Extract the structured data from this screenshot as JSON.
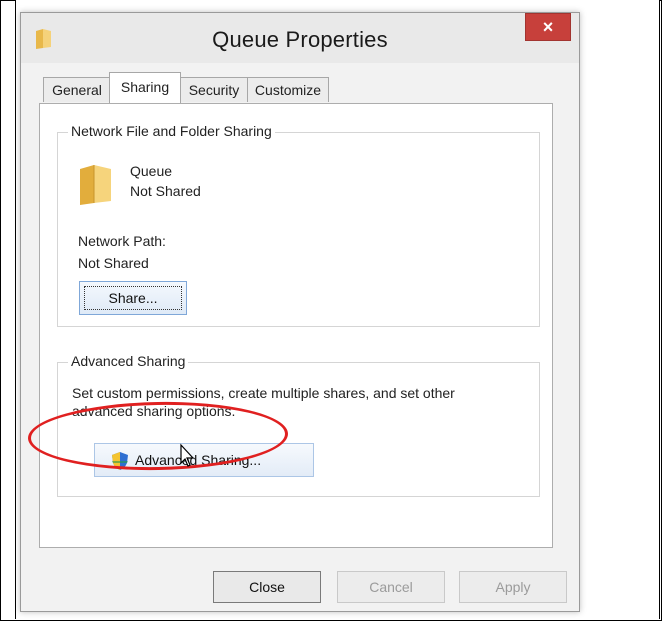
{
  "window": {
    "title": "Queue Properties",
    "close_label": "×"
  },
  "tabs": [
    {
      "label": "General",
      "active": false
    },
    {
      "label": "Sharing",
      "active": true
    },
    {
      "label": "Security",
      "active": false
    },
    {
      "label": "Customize",
      "active": false
    }
  ],
  "network_sharing": {
    "legend": "Network File and Folder Sharing",
    "folder_name": "Queue",
    "folder_status": "Not Shared",
    "network_path_label": "Network Path:",
    "network_path_value": "Not Shared",
    "share_button": "Share..."
  },
  "advanced_sharing": {
    "legend": "Advanced Sharing",
    "description_line1": "Set custom permissions, create multiple shares, and set other",
    "description_line2": "advanced sharing options.",
    "button": "Advanced Sharing..."
  },
  "footer": {
    "close": "Close",
    "cancel": "Cancel",
    "apply": "Apply"
  },
  "colors": {
    "highlight": "#e02020",
    "close_button": "#c7403b",
    "folder": "#f3c35a"
  }
}
